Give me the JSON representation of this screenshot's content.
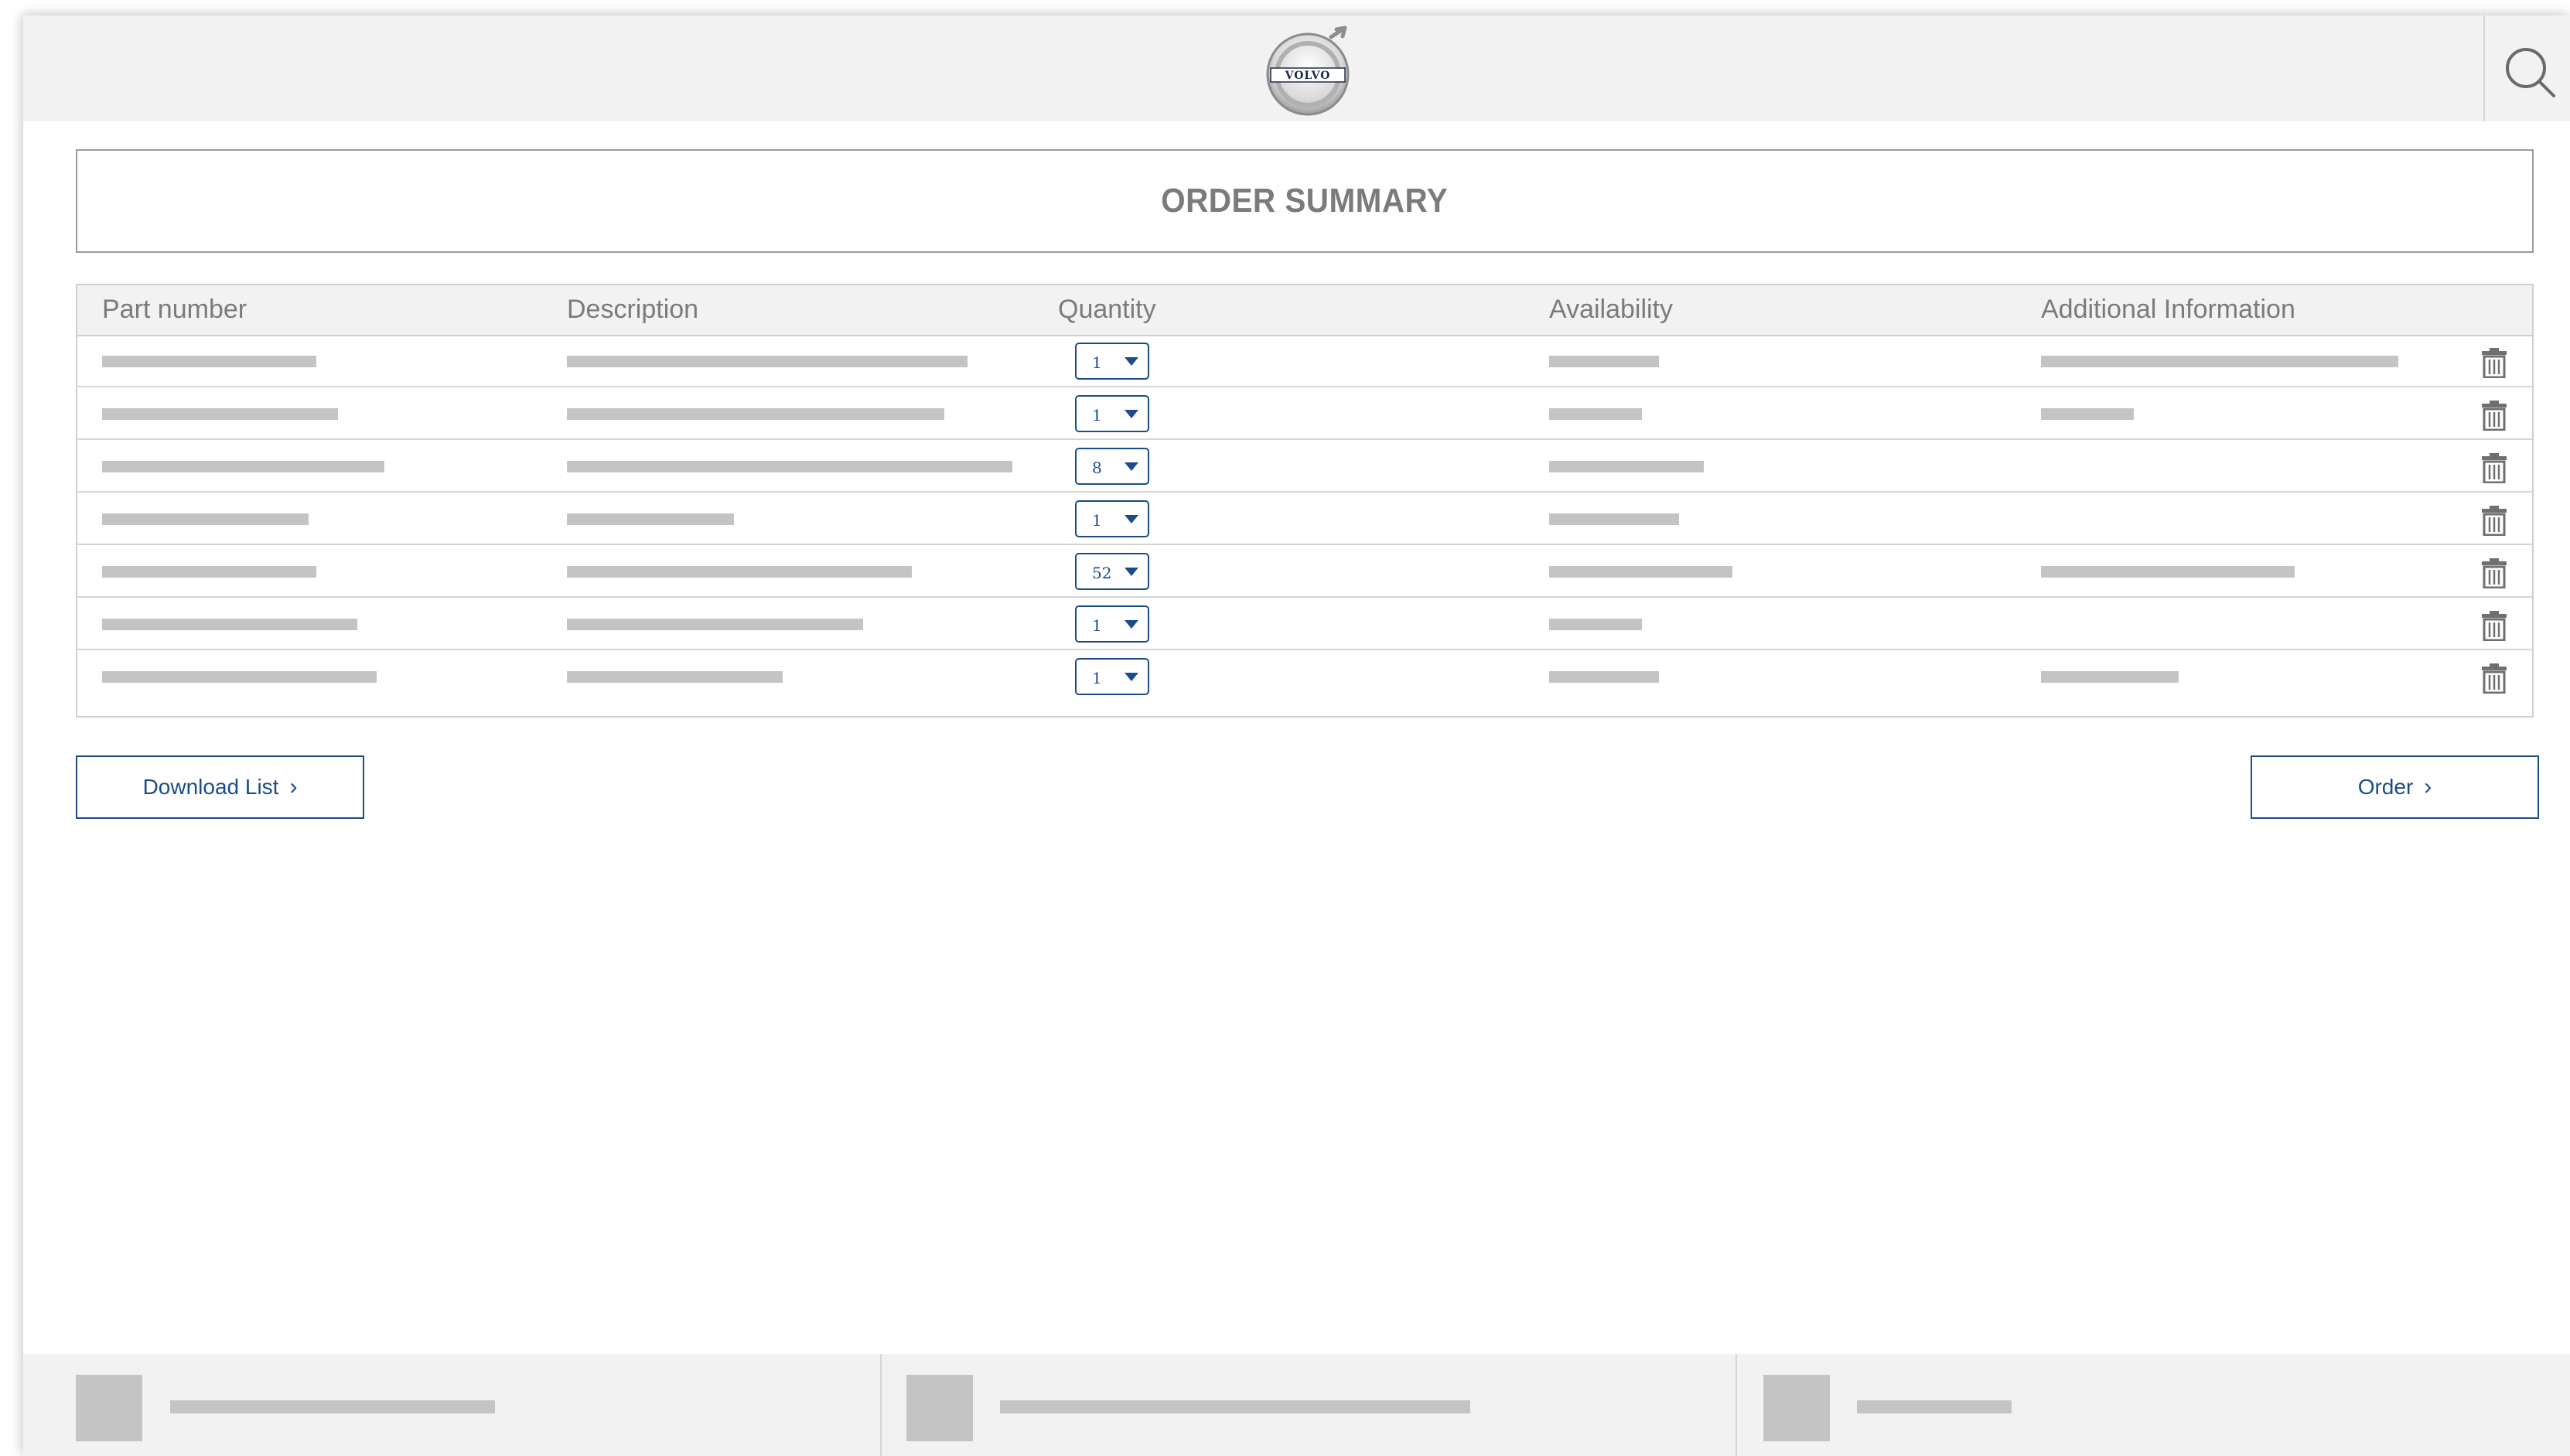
{
  "header": {
    "logo_text": "VOLVO",
    "search_icon": "search-icon",
    "logo_icon": "volvo-logo"
  },
  "page": {
    "title": "ORDER SUMMARY"
  },
  "table": {
    "columns": {
      "part_number": "Part number",
      "description": "Description",
      "quantity": "Quantity",
      "availability": "Availability",
      "additional": "Additional Information"
    },
    "rows": [
      {
        "quantity": "1"
      },
      {
        "quantity": "1"
      },
      {
        "quantity": "8"
      },
      {
        "quantity": "1"
      },
      {
        "quantity": "52"
      },
      {
        "quantity": "1"
      },
      {
        "quantity": "1"
      }
    ],
    "row_action_icon": "trash-icon"
  },
  "actions": {
    "download_label": "Download List",
    "order_label": "Order",
    "chevron": "›"
  },
  "colors": {
    "accent": "#1a4b8c",
    "header_bg": "#f2f2f2",
    "placeholder": "#c4c4c4",
    "title_text": "#7b7b7b"
  }
}
